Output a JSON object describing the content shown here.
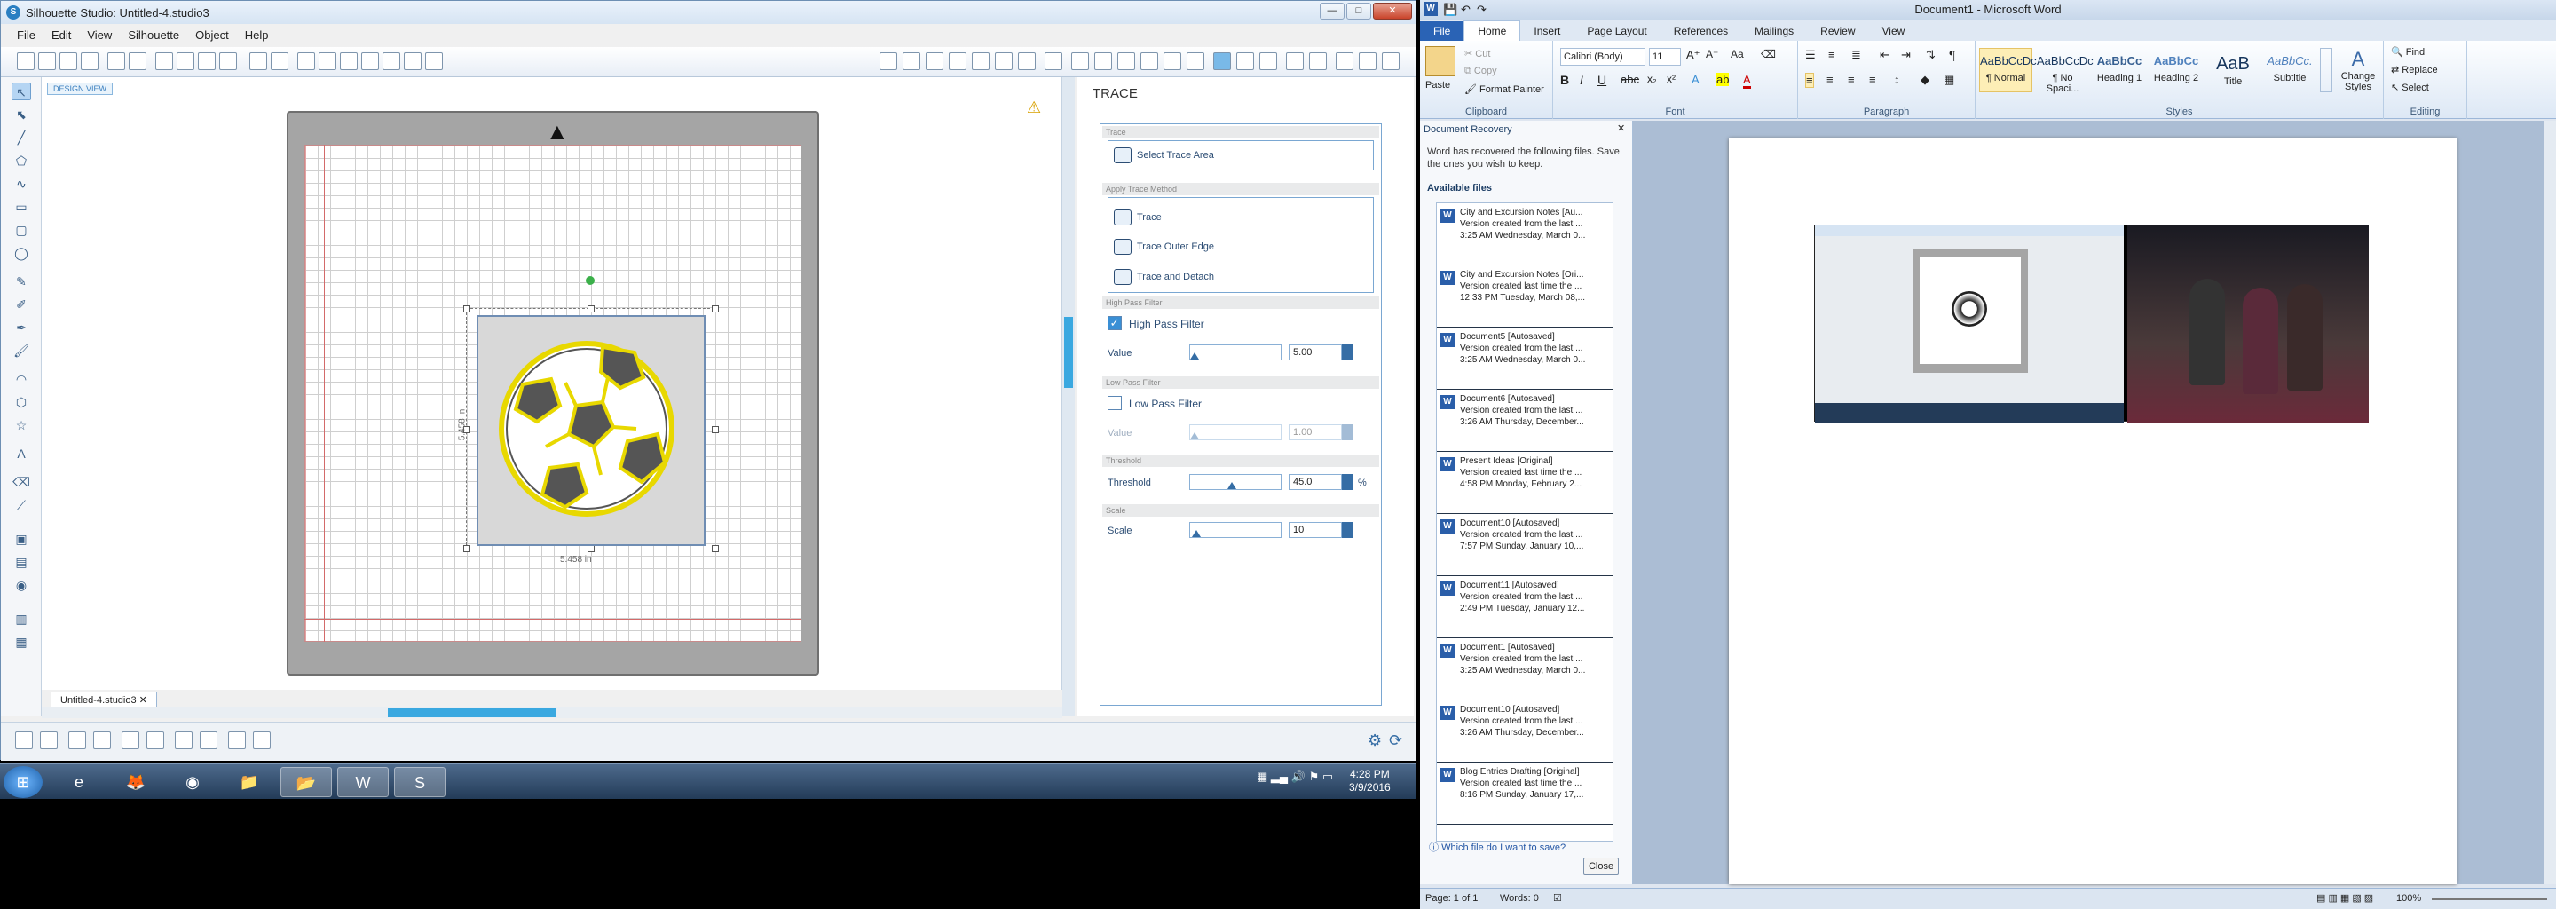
{
  "silhouette": {
    "title": "Silhouette Studio: Untitled-4.studio3",
    "menu": [
      "File",
      "Edit",
      "View",
      "Silhouette",
      "Object",
      "Help"
    ],
    "design_view_tag": "DESIGN VIEW",
    "dim_width": "5.458 in",
    "dim_height": "5.458 in",
    "doc_tab": "Untitled-4.studio3",
    "trace": {
      "title": "TRACE",
      "sections": {
        "trace": "Trace",
        "method": "Apply Trace Method",
        "high": "High Pass Filter",
        "low": "Low Pass Filter",
        "threshold": "Threshold",
        "scale": "Scale"
      },
      "select_area": "Select Trace Area",
      "methods": [
        "Trace",
        "Trace Outer Edge",
        "Trace and Detach"
      ],
      "high_pass_label": "High Pass Filter",
      "high_pass_checked": true,
      "high_value_label": "Value",
      "high_value": "5.00",
      "low_pass_label": "Low Pass Filter",
      "low_pass_checked": false,
      "low_value_label": "Value",
      "low_value": "1.00",
      "threshold_label": "Threshold",
      "threshold_value": "45.0",
      "threshold_unit": "%",
      "scale_label": "Scale",
      "scale_value": "10"
    }
  },
  "taskbar": {
    "time": "4:28 PM",
    "date": "3/9/2016"
  },
  "word": {
    "title": "Document1 - Microsoft Word",
    "tabs": [
      "File",
      "Home",
      "Insert",
      "Page Layout",
      "References",
      "Mailings",
      "Review",
      "View"
    ],
    "clipboard": {
      "paste": "Paste",
      "cut": "Cut",
      "copy": "Copy",
      "format_painter": "Format Painter",
      "label": "Clipboard"
    },
    "font": {
      "name": "Calibri (Body)",
      "size": "11",
      "label": "Font"
    },
    "paragraph_label": "Paragraph",
    "styles": [
      {
        "preview": "AaBbCcDc",
        "name": "¶ Normal"
      },
      {
        "preview": "AaBbCcDc",
        "name": "¶ No Spaci..."
      },
      {
        "preview": "AaBbCc",
        "name": "Heading 1"
      },
      {
        "preview": "AaBbCc",
        "name": "Heading 2"
      },
      {
        "preview": "AaB",
        "name": "Title"
      },
      {
        "preview": "AaBbCc.",
        "name": "Subtitle"
      }
    ],
    "styles_label": "Styles",
    "change_styles": "Change Styles",
    "editing": {
      "find": "Find",
      "replace": "Replace",
      "select": "Select",
      "label": "Editing"
    },
    "recovery": {
      "header": "Document Recovery",
      "desc": "Word has recovered the following files.  Save the ones you wish to keep.",
      "available": "Available files",
      "items": [
        {
          "name": "City and Excursion Notes  [Au...",
          "line2": "Version created from the last ...",
          "line3": "3:25 AM Wednesday, March 0..."
        },
        {
          "name": "City and Excursion Notes  [Ori...",
          "line2": "Version created last time the ...",
          "line3": "12:33 PM Tuesday, March 08,..."
        },
        {
          "name": "Document5  [Autosaved]",
          "line2": "Version created from the last ...",
          "line3": "3:25 AM Wednesday, March 0..."
        },
        {
          "name": "Document6  [Autosaved]",
          "line2": "Version created from the last ...",
          "line3": "3:26 AM Thursday, December..."
        },
        {
          "name": "Present Ideas  [Original]",
          "line2": "Version created last time the ...",
          "line3": "4:58 PM Monday, February 2..."
        },
        {
          "name": "Document10  [Autosaved]",
          "line2": "Version created from the last ...",
          "line3": "7:57 PM Sunday, January 10,..."
        },
        {
          "name": "Document11  [Autosaved]",
          "line2": "Version created from the last ...",
          "line3": "2:49 PM Tuesday, January 12..."
        },
        {
          "name": "Document1  [Autosaved]",
          "line2": "Version created from the last ...",
          "line3": "3:25 AM Wednesday, March 0..."
        },
        {
          "name": "Document10  [Autosaved]",
          "line2": "Version created from the last ...",
          "line3": "3:26 AM Thursday, December..."
        },
        {
          "name": "Blog Entries Drafting  [Original]",
          "line2": "Version created last time the ...",
          "line3": "8:16 PM Sunday, January 17,..."
        }
      ],
      "link": "Which file do I want to save?",
      "close": "Close"
    },
    "status": {
      "page": "Page: 1 of 1",
      "words": "Words: 0",
      "zoom": "100%"
    }
  }
}
